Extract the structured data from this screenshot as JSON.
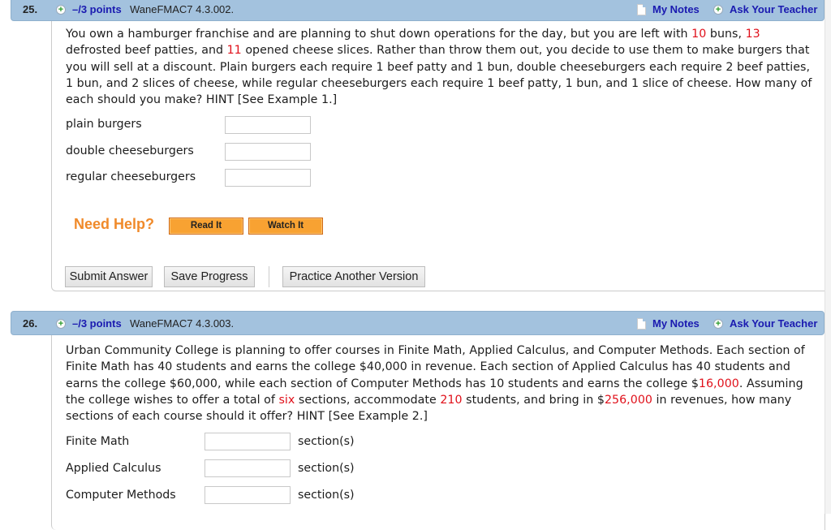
{
  "questions": [
    {
      "number": "25.",
      "points": "–/3 points",
      "code": "WaneFMAC7 4.3.002.",
      "my_notes": "My Notes",
      "ask_teacher": "Ask Your Teacher",
      "prompt": [
        {
          "t": "You own a hamburger franchise and are planning to shut down operations for the day, but you are left with "
        },
        {
          "t": "10",
          "red": true
        },
        {
          "t": " buns, "
        },
        {
          "t": "13",
          "red": true
        },
        {
          "t": " defrosted beef patties, and "
        },
        {
          "t": "11",
          "red": true
        },
        {
          "t": " opened cheese slices. Rather than throw them out, you decide to use them to make burgers that you will sell at a discount. Plain burgers each require 1 beef patty and 1 bun, double cheeseburgers each require 2 beef patties, 1 bun, and 2 slices of cheese, while regular cheeseburgers each require 1 beef patty, 1 bun, and 1 slice of cheese. How many of each should you make? HINT [See Example 1.]"
        }
      ],
      "fields": [
        {
          "label": "plain burgers",
          "value": ""
        },
        {
          "label": "double cheeseburgers",
          "value": ""
        },
        {
          "label": "regular cheeseburgers",
          "value": ""
        }
      ],
      "need_help": "Need Help?",
      "read_it": "Read It",
      "watch_it": "Watch It",
      "submit": "Submit Answer",
      "save": "Save Progress",
      "practice": "Practice Another Version"
    },
    {
      "number": "26.",
      "points": "–/3 points",
      "code": "WaneFMAC7 4.3.003.",
      "my_notes": "My Notes",
      "ask_teacher": "Ask Your Teacher",
      "prompt": [
        {
          "t": "Urban Community College is planning to offer courses in Finite Math, Applied Calculus, and Computer Methods. Each section of Finite Math has 40 students and earns the college $40,000 in revenue. Each section of Applied Calculus has 40 students and earns the college $60,000, while each section of Computer Methods has 10 students and earns the college $"
        },
        {
          "t": "16,000",
          "red": true
        },
        {
          "t": ". Assuming the college wishes to offer a total of "
        },
        {
          "t": "six",
          "red": true
        },
        {
          "t": " sections, accommodate "
        },
        {
          "t": "210",
          "red": true
        },
        {
          "t": " students, and bring in $"
        },
        {
          "t": "256,000",
          "red": true
        },
        {
          "t": " in revenues, how many sections of each course should it offer? HINT [See Example 2.]"
        }
      ],
      "fields": [
        {
          "label": "Finite Math",
          "value": "",
          "unit": "section(s)"
        },
        {
          "label": "Applied Calculus",
          "value": "",
          "unit": "section(s)"
        },
        {
          "label": "Computer Methods",
          "value": "",
          "unit": "section(s)"
        }
      ]
    }
  ],
  "colors": {
    "header_bg": "#a3c2de",
    "link": "#1a1ab0",
    "highlight": "#e0101a",
    "help_orange": "#f08a2a"
  }
}
